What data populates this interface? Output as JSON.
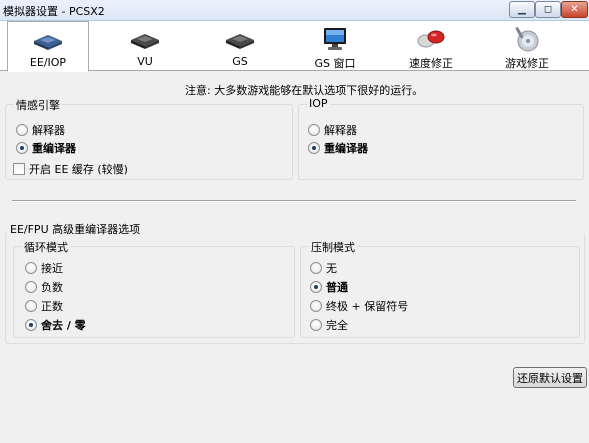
{
  "window": {
    "title": "模拟器设置 - PCSX2",
    "buttons": {
      "minimize": "▁",
      "maximize": "◻",
      "close": "✕"
    }
  },
  "tabs": [
    {
      "label": "EE/IOP",
      "icon": "chip-blue-icon",
      "selected": true
    },
    {
      "label": "VU",
      "icon": "chip-icon",
      "selected": false
    },
    {
      "label": "GS",
      "icon": "chip-icon",
      "selected": false
    },
    {
      "label": "GS 窗口",
      "icon": "monitor-icon",
      "selected": false
    },
    {
      "label": "速度修正",
      "icon": "pill-icon",
      "selected": false
    },
    {
      "label": "游戏修正",
      "icon": "disc-icon",
      "selected": false
    }
  ],
  "notice": "注意: 大多数游戏能够在默认选项下很好的运行。",
  "ee_group": {
    "title": "情感引擎",
    "options": [
      {
        "label": "解释器",
        "selected": false
      },
      {
        "label": "重编译器",
        "selected": true
      }
    ],
    "cache_checkbox": {
      "label": "开启 EE 缓存 (较慢)",
      "checked": false
    }
  },
  "iop_group": {
    "title": "IOP",
    "options": [
      {
        "label": "解释器",
        "selected": false
      },
      {
        "label": "重编译器",
        "selected": true
      }
    ]
  },
  "recompiler_section": {
    "title": "EE/FPU 高级重编译器选项",
    "rounding": {
      "title": "循环模式",
      "options": [
        {
          "label": "接近",
          "selected": false
        },
        {
          "label": "负数",
          "selected": false
        },
        {
          "label": "正数",
          "selected": false
        },
        {
          "label": "舍去 / 零",
          "selected": true
        }
      ]
    },
    "clamping": {
      "title": "压制模式",
      "options": [
        {
          "label": "无",
          "selected": false
        },
        {
          "label": "普通",
          "selected": true
        },
        {
          "label": "终极 + 保留符号",
          "selected": false
        },
        {
          "label": "完全",
          "selected": false
        }
      ]
    }
  },
  "restore_button": "还原默认设置"
}
